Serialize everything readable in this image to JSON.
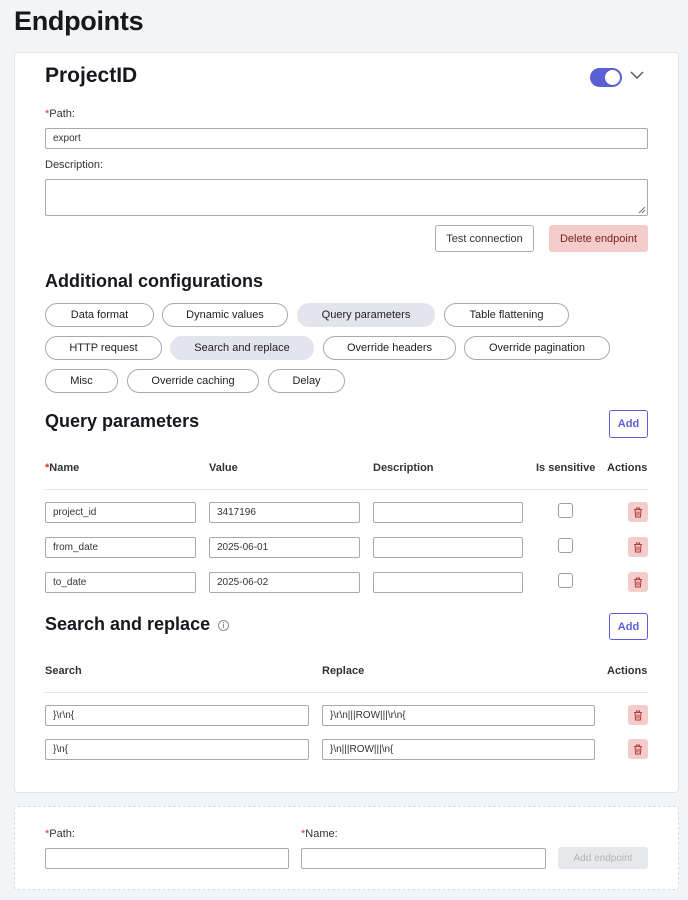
{
  "page_title": "Endpoints",
  "endpoint": {
    "name": "ProjectID",
    "enabled": true,
    "path_label": "Path:",
    "path_required": "*",
    "path_value": "export",
    "description_label": "Description:",
    "description_value": "",
    "test_connection": "Test connection",
    "delete_endpoint": "Delete endpoint"
  },
  "additional": {
    "title": "Additional configurations",
    "chips": [
      {
        "label": "Data format",
        "active": false
      },
      {
        "label": "Dynamic values",
        "active": false
      },
      {
        "label": "Query parameters",
        "active": true
      },
      {
        "label": "Table flattening",
        "active": false
      },
      {
        "label": "HTTP request",
        "active": false
      },
      {
        "label": "Search and replace",
        "active": true
      },
      {
        "label": "Override headers",
        "active": false
      },
      {
        "label": "Override pagination",
        "active": false
      },
      {
        "label": "Misc",
        "active": false
      },
      {
        "label": "Override caching",
        "active": false
      },
      {
        "label": "Delay",
        "active": false
      }
    ]
  },
  "query_params": {
    "title": "Query parameters",
    "add": "Add",
    "columns": {
      "name_req": "*",
      "name": "Name",
      "value": "Value",
      "description": "Description",
      "sensitive": "Is sensitive",
      "actions": "Actions"
    },
    "rows": [
      {
        "name": "project_id",
        "value": "3417196",
        "description": "",
        "sensitive": false
      },
      {
        "name": "from_date",
        "value": "2025-06-01",
        "description": "",
        "sensitive": false
      },
      {
        "name": "to_date",
        "value": "2025-06-02",
        "description": "",
        "sensitive": false
      }
    ]
  },
  "search_replace": {
    "title": "Search and replace",
    "info": "i",
    "add": "Add",
    "columns": {
      "search": "Search",
      "replace": "Replace",
      "actions": "Actions"
    },
    "rows": [
      {
        "search": "}\\r\\n{",
        "replace": "}\\r\\n|||ROW|||\\r\\n{"
      },
      {
        "search": "}\\n{",
        "replace": "}\\n|||ROW|||\\n{"
      }
    ]
  },
  "new_endpoint": {
    "required": "*",
    "path_label": "Path:",
    "name_label": "Name:",
    "path_value": "",
    "name_value": "",
    "add_button": "Add endpoint"
  },
  "colors": {
    "accent": "#5b5fd6",
    "danger_bg": "#f4cccc",
    "chip_active": "#e3e4ee"
  }
}
